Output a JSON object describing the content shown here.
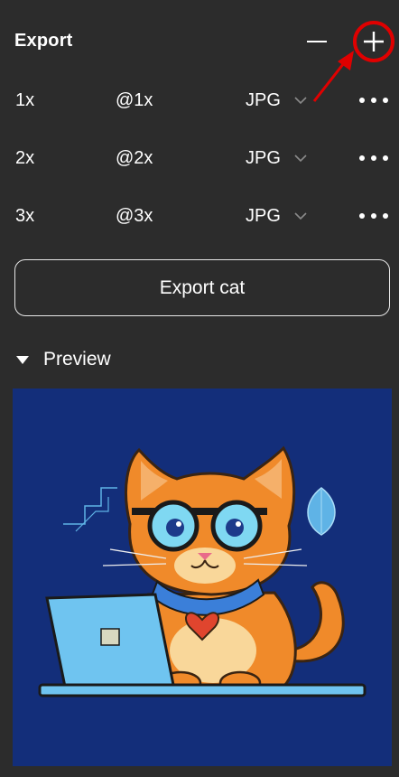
{
  "panel": {
    "title": "Export"
  },
  "export_rows": [
    {
      "scale": "1x",
      "suffix": "@1x",
      "format": "JPG"
    },
    {
      "scale": "2x",
      "suffix": "@2x",
      "format": "JPG"
    },
    {
      "scale": "3x",
      "suffix": "@3x",
      "format": "JPG"
    }
  ],
  "export_button": {
    "label": "Export cat"
  },
  "preview": {
    "label": "Preview",
    "image": "orange-cat-with-glasses-and-laptop"
  },
  "colors": {
    "panel_bg": "#2c2c2c",
    "annotation_red": "#e00000",
    "preview_bg": "#132e7a"
  }
}
